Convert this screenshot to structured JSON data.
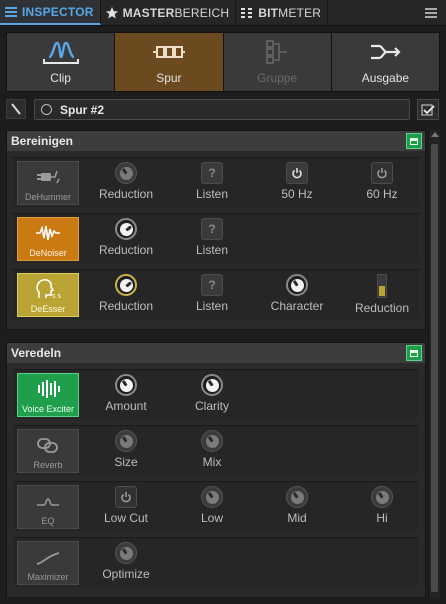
{
  "tabs": [
    {
      "bold": "INSPECTOR",
      "thin": "",
      "icon": "list-icon",
      "active": true
    },
    {
      "bold": "MASTER",
      "thin": "BEREICH",
      "icon": "star-icon",
      "active": false
    },
    {
      "bold": "BIT",
      "thin": "METER",
      "icon": "meter-icon",
      "active": false
    }
  ],
  "categories": [
    {
      "label": "Clip",
      "icon": "waveform-icon",
      "state": "normal"
    },
    {
      "label": "Spur",
      "icon": "track-icon",
      "state": "selected"
    },
    {
      "label": "Gruppe",
      "icon": "group-icon",
      "state": "disabled"
    },
    {
      "label": "Ausgabe",
      "icon": "output-icon",
      "state": "normal"
    }
  ],
  "track": {
    "name": "Spur #2"
  },
  "sections": {
    "bereinigen": {
      "title": "Bereinigen",
      "modules": {
        "dehummer": {
          "label": "DeHummer",
          "controls": [
            "Reduction",
            "Listen",
            "50 Hz",
            "60 Hz"
          ]
        },
        "denoiser": {
          "label": "DeNoiser",
          "controls": [
            "Reduction",
            "Listen"
          ]
        },
        "deesser": {
          "label": "DeEsser",
          "controls": [
            "Reduction",
            "Listen",
            "Character",
            "Reduction"
          ],
          "reduction_level": 0.45
        }
      }
    },
    "veredeln": {
      "title": "Veredeln",
      "modules": {
        "exciter": {
          "label": "Voice Exciter",
          "controls": [
            "Amount",
            "Clarity"
          ]
        },
        "reverb": {
          "label": "Reverb",
          "controls": [
            "Size",
            "Mix"
          ]
        },
        "eq": {
          "label": "EQ",
          "controls": [
            "Low Cut",
            "Low",
            "Mid",
            "Hi"
          ]
        },
        "maximizer": {
          "label": "Maximizer",
          "controls": [
            "Optimize"
          ]
        }
      }
    }
  },
  "colors": {
    "accent": "#58a6e6",
    "selected": "#6c4a1f",
    "orange": "#c97a12",
    "yellow": "#b9a332",
    "green": "#1f9e4c"
  }
}
